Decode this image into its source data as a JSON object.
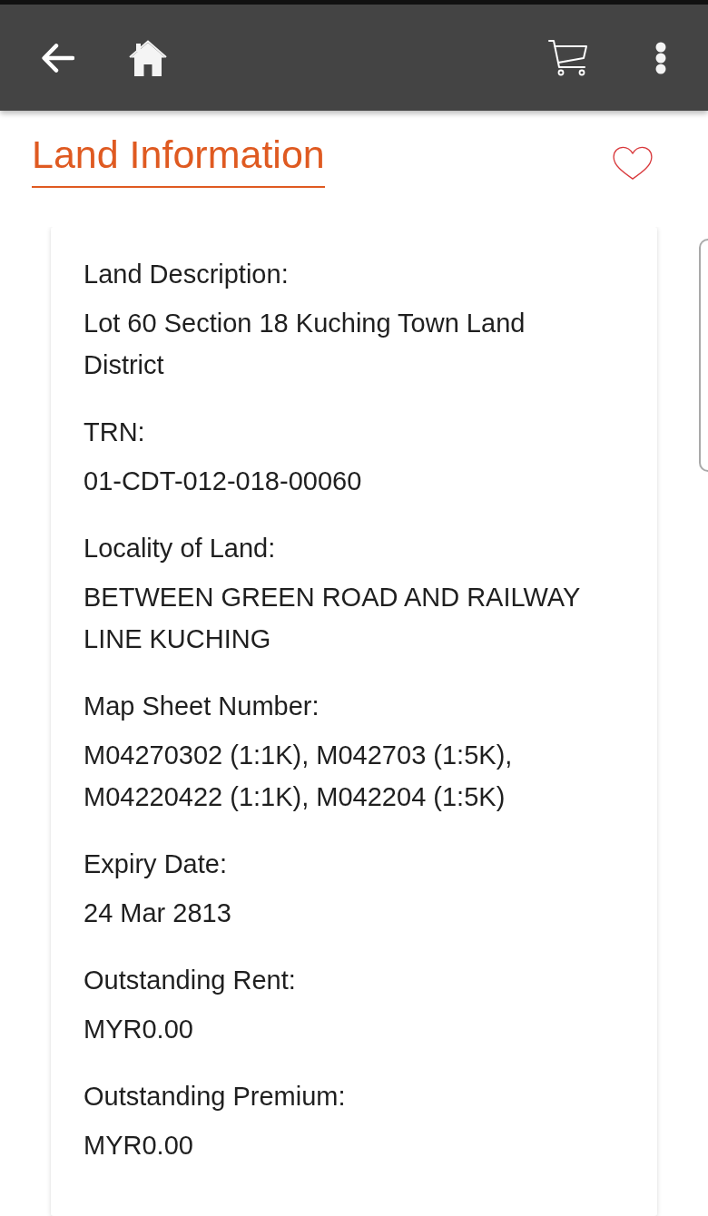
{
  "page": {
    "title": "Land Information",
    "favorite": false
  },
  "fields": [
    {
      "label": "Land Description:",
      "value": "Lot 60 Section 18 Kuching Town Land District"
    },
    {
      "label": "TRN:",
      "value": "01-CDT-012-018-00060"
    },
    {
      "label": "Locality of Land:",
      "value": "BETWEEN GREEN ROAD AND RAILWAY LINE KUCHING"
    },
    {
      "label": "Map Sheet Number:",
      "value": "M04270302 (1:1K), M042703 (1:5K), M04220422 (1:1K), M042204 (1:5K)"
    },
    {
      "label": "Expiry Date:",
      "value": "24 Mar 2813"
    },
    {
      "label": "Outstanding Rent:",
      "value": "MYR0.00"
    },
    {
      "label": "Outstanding Premium:",
      "value": "MYR0.00"
    }
  ]
}
